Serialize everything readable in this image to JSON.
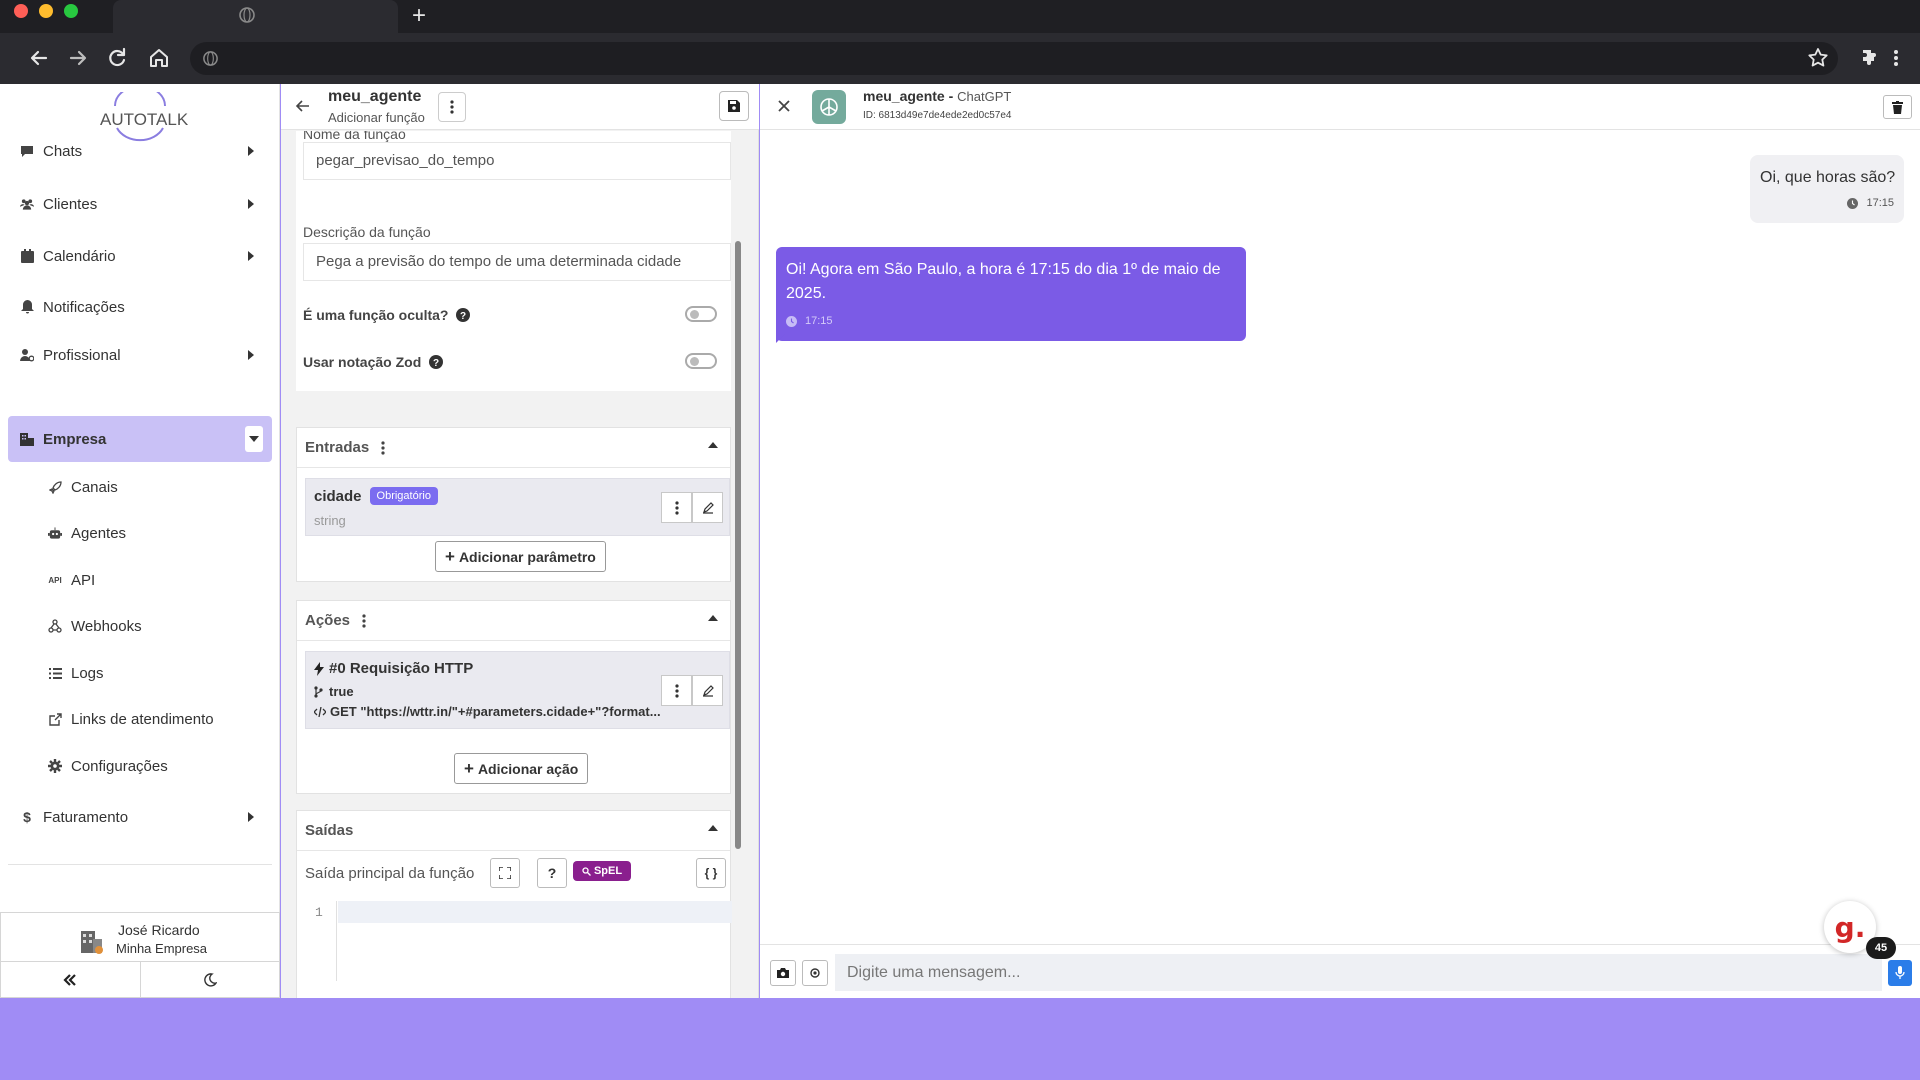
{
  "browser": {
    "colors": {
      "close": "#ff5f57",
      "minimize": "#febc2e",
      "maximize": "#28c840"
    }
  },
  "sidebar": {
    "logo_text": "AUTOTALK",
    "items": [
      {
        "label": "Chats",
        "icon": "chat-icon"
      },
      {
        "label": "Clientes",
        "icon": "users-icon"
      },
      {
        "label": "Calendário",
        "icon": "calendar-icon"
      },
      {
        "label": "Notificações",
        "icon": "bell-icon"
      },
      {
        "label": "Profissional",
        "icon": "user-gear-icon"
      },
      {
        "label": "Empresa",
        "icon": "building-icon",
        "active": true
      },
      {
        "label": "Faturamento",
        "icon": "dollar-icon"
      }
    ],
    "subitems": [
      {
        "label": "Canais",
        "icon": "rocket-icon"
      },
      {
        "label": "Agentes",
        "icon": "robot-icon"
      },
      {
        "label": "API",
        "icon": "api-icon"
      },
      {
        "label": "Webhooks",
        "icon": "webhook-icon"
      },
      {
        "label": "Logs",
        "icon": "list-icon"
      },
      {
        "label": "Links de atendimento",
        "icon": "external-link-icon"
      },
      {
        "label": "Configurações",
        "icon": "gear-icon"
      }
    ],
    "user": {
      "name": "José Ricardo",
      "company": "Minha Empresa"
    }
  },
  "editor": {
    "agent_name": "meu_agente",
    "subtitle": "Adicionar função",
    "function_name_label": "Nome da função",
    "function_name_value": "pegar_previsao_do_tempo",
    "description_label": "Descrição da função",
    "description_value": "Pega a previsão do tempo de uma determinada cidade",
    "hidden_label": "É uma função oculta?",
    "hidden_on": false,
    "zod_label": "Usar notação Zod",
    "zod_on": false,
    "inputs": {
      "title": "Entradas",
      "param_name": "cidade",
      "param_badge": "Obrigatório",
      "param_type": "string",
      "add_label": "Adicionar parâmetro"
    },
    "actions": {
      "title": "Ações",
      "action_title": "#0 Requisição HTTP",
      "condition": "true",
      "request": "GET \"https://wttr.in/\"+#parameters.cidade+\"?format...",
      "add_label": "Adicionar ação"
    },
    "outputs": {
      "title": "Saídas",
      "main_output_label": "Saída principal da função",
      "help_label": "?",
      "spel_label": "SpEL",
      "braces_label": "{ }",
      "line_number": "1"
    }
  },
  "chat": {
    "agent_name": "meu_agente",
    "model": "ChatGPT",
    "id_text": "ID: 6813d49e7de4ede2ed0c57e4",
    "messages": [
      {
        "from": "user",
        "text": "Oi, que horas são?",
        "time": "17:15"
      },
      {
        "from": "bot",
        "text": "Oi! Agora em São Paulo, a hora é 17:15 do dia 1º de maio de 2025.",
        "time": "17:15"
      }
    ],
    "input_placeholder": "Digite uma mensagem...",
    "widget_letter": "g.",
    "widget_count": "45",
    "bot_color": "#7b5be6"
  }
}
